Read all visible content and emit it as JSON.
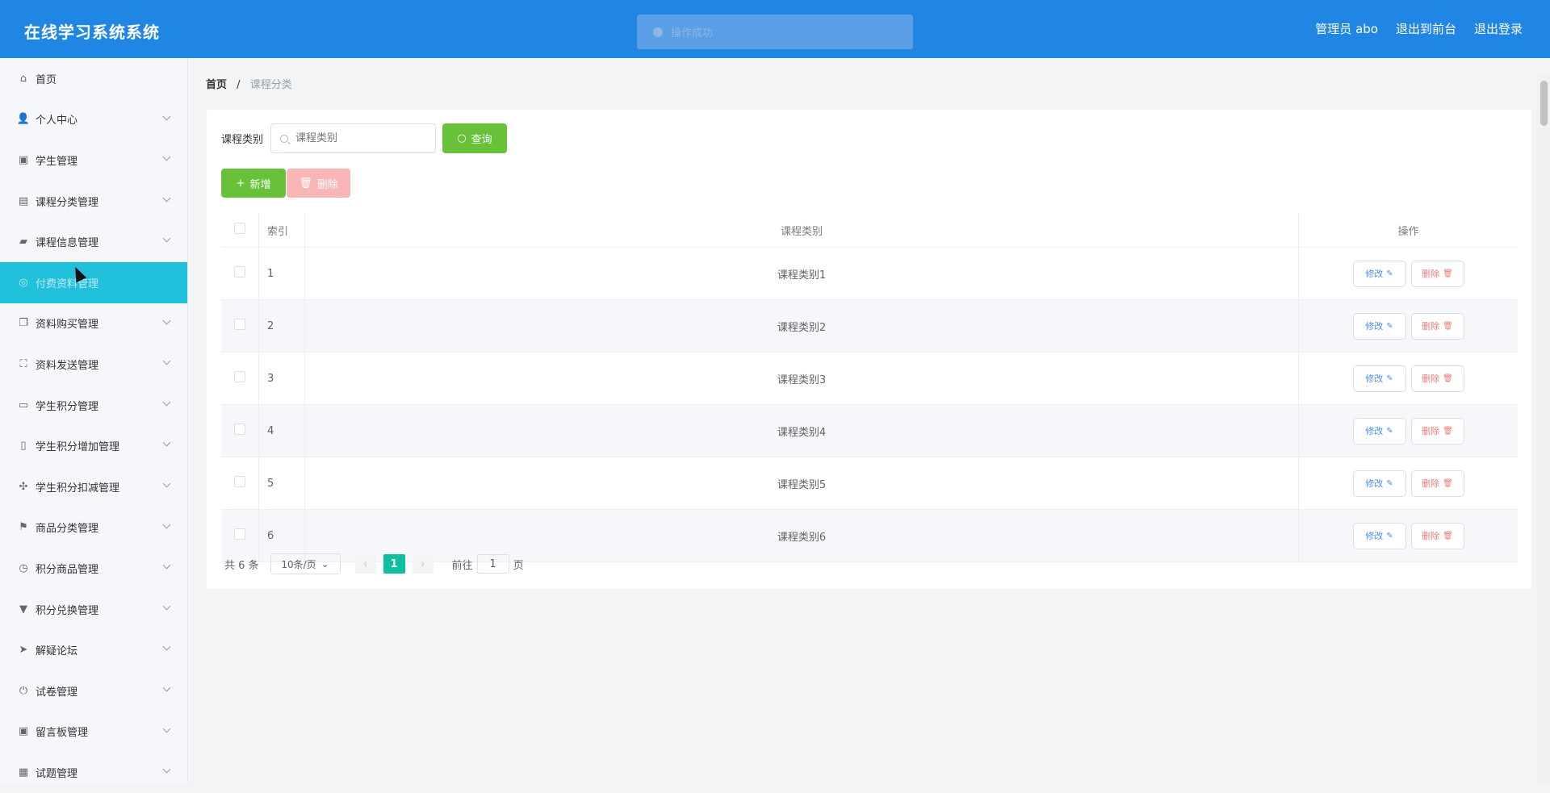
{
  "app": {
    "title": "在线学习系统系统",
    "user": "管理员 abo",
    "back_front": "退出到前台",
    "logout": "退出登录"
  },
  "toast": "操作成功",
  "breadcrumb": {
    "home": "首页",
    "separator": "/",
    "current": "课程分类"
  },
  "sidebar": {
    "items": [
      {
        "label": "首页",
        "icon": "home-icon",
        "glyph": "⌂",
        "chevron": false
      },
      {
        "label": "个人中心",
        "icon": "user-icon",
        "glyph": "👤",
        "chevron": true
      },
      {
        "label": "学生管理",
        "icon": "clipboard-icon",
        "glyph": "▣",
        "chevron": true
      },
      {
        "label": "课程分类管理",
        "icon": "message-icon",
        "glyph": "▤",
        "chevron": true
      },
      {
        "label": "课程信息管理",
        "icon": "folder-icon",
        "glyph": "▰",
        "chevron": true
      },
      {
        "label": "付费资料管理",
        "icon": "coin-icon",
        "glyph": "◎",
        "chevron": false,
        "active": true
      },
      {
        "label": "资料购买管理",
        "icon": "copy-icon",
        "glyph": "❐",
        "chevron": true
      },
      {
        "label": "资料发送管理",
        "icon": "fullscreen-icon",
        "glyph": "⛶",
        "chevron": true
      },
      {
        "label": "学生积分管理",
        "icon": "card-icon",
        "glyph": "▭",
        "chevron": true
      },
      {
        "label": "学生积分增加管理",
        "icon": "mic-icon",
        "glyph": "▯",
        "chevron": true
      },
      {
        "label": "学生积分扣减管理",
        "icon": "target-icon",
        "glyph": "✣",
        "chevron": true
      },
      {
        "label": "商品分类管理",
        "icon": "flag-icon",
        "glyph": "⚑",
        "chevron": true
      },
      {
        "label": "积分商品管理",
        "icon": "compass-icon",
        "glyph": "◷",
        "chevron": true
      },
      {
        "label": "积分兑换管理",
        "icon": "brush-icon",
        "glyph": "▼",
        "chevron": true
      },
      {
        "label": "解疑论坛",
        "icon": "send-icon",
        "glyph": "➤",
        "chevron": true
      },
      {
        "label": "试卷管理",
        "icon": "power-icon",
        "glyph": "⏻",
        "chevron": true
      },
      {
        "label": "留言板管理",
        "icon": "clipboard-check-icon",
        "glyph": "▣",
        "chevron": true
      },
      {
        "label": "试题管理",
        "icon": "grid-icon",
        "glyph": "▦",
        "chevron": true
      }
    ]
  },
  "search": {
    "label": "课程类别",
    "placeholder": "课程类别",
    "query_button": "查询"
  },
  "toolbar": {
    "add": "新增",
    "delete": "删除"
  },
  "table": {
    "headers": {
      "index": "索引",
      "category": "课程类别",
      "operation": "操作"
    },
    "rows": [
      {
        "index": "1",
        "category": "课程类别1"
      },
      {
        "index": "2",
        "category": "课程类别2"
      },
      {
        "index": "3",
        "category": "课程类别3"
      },
      {
        "index": "4",
        "category": "课程类别4"
      },
      {
        "index": "5",
        "category": "课程类别5"
      },
      {
        "index": "6",
        "category": "课程类别6"
      }
    ],
    "edit_label": "修改",
    "delete_label": "删除"
  },
  "pagination": {
    "total": "共 6 条",
    "page_size": "10条/页",
    "current_page": "1",
    "goto_label": "前往",
    "goto_value": "1",
    "page_suffix": "页"
  }
}
